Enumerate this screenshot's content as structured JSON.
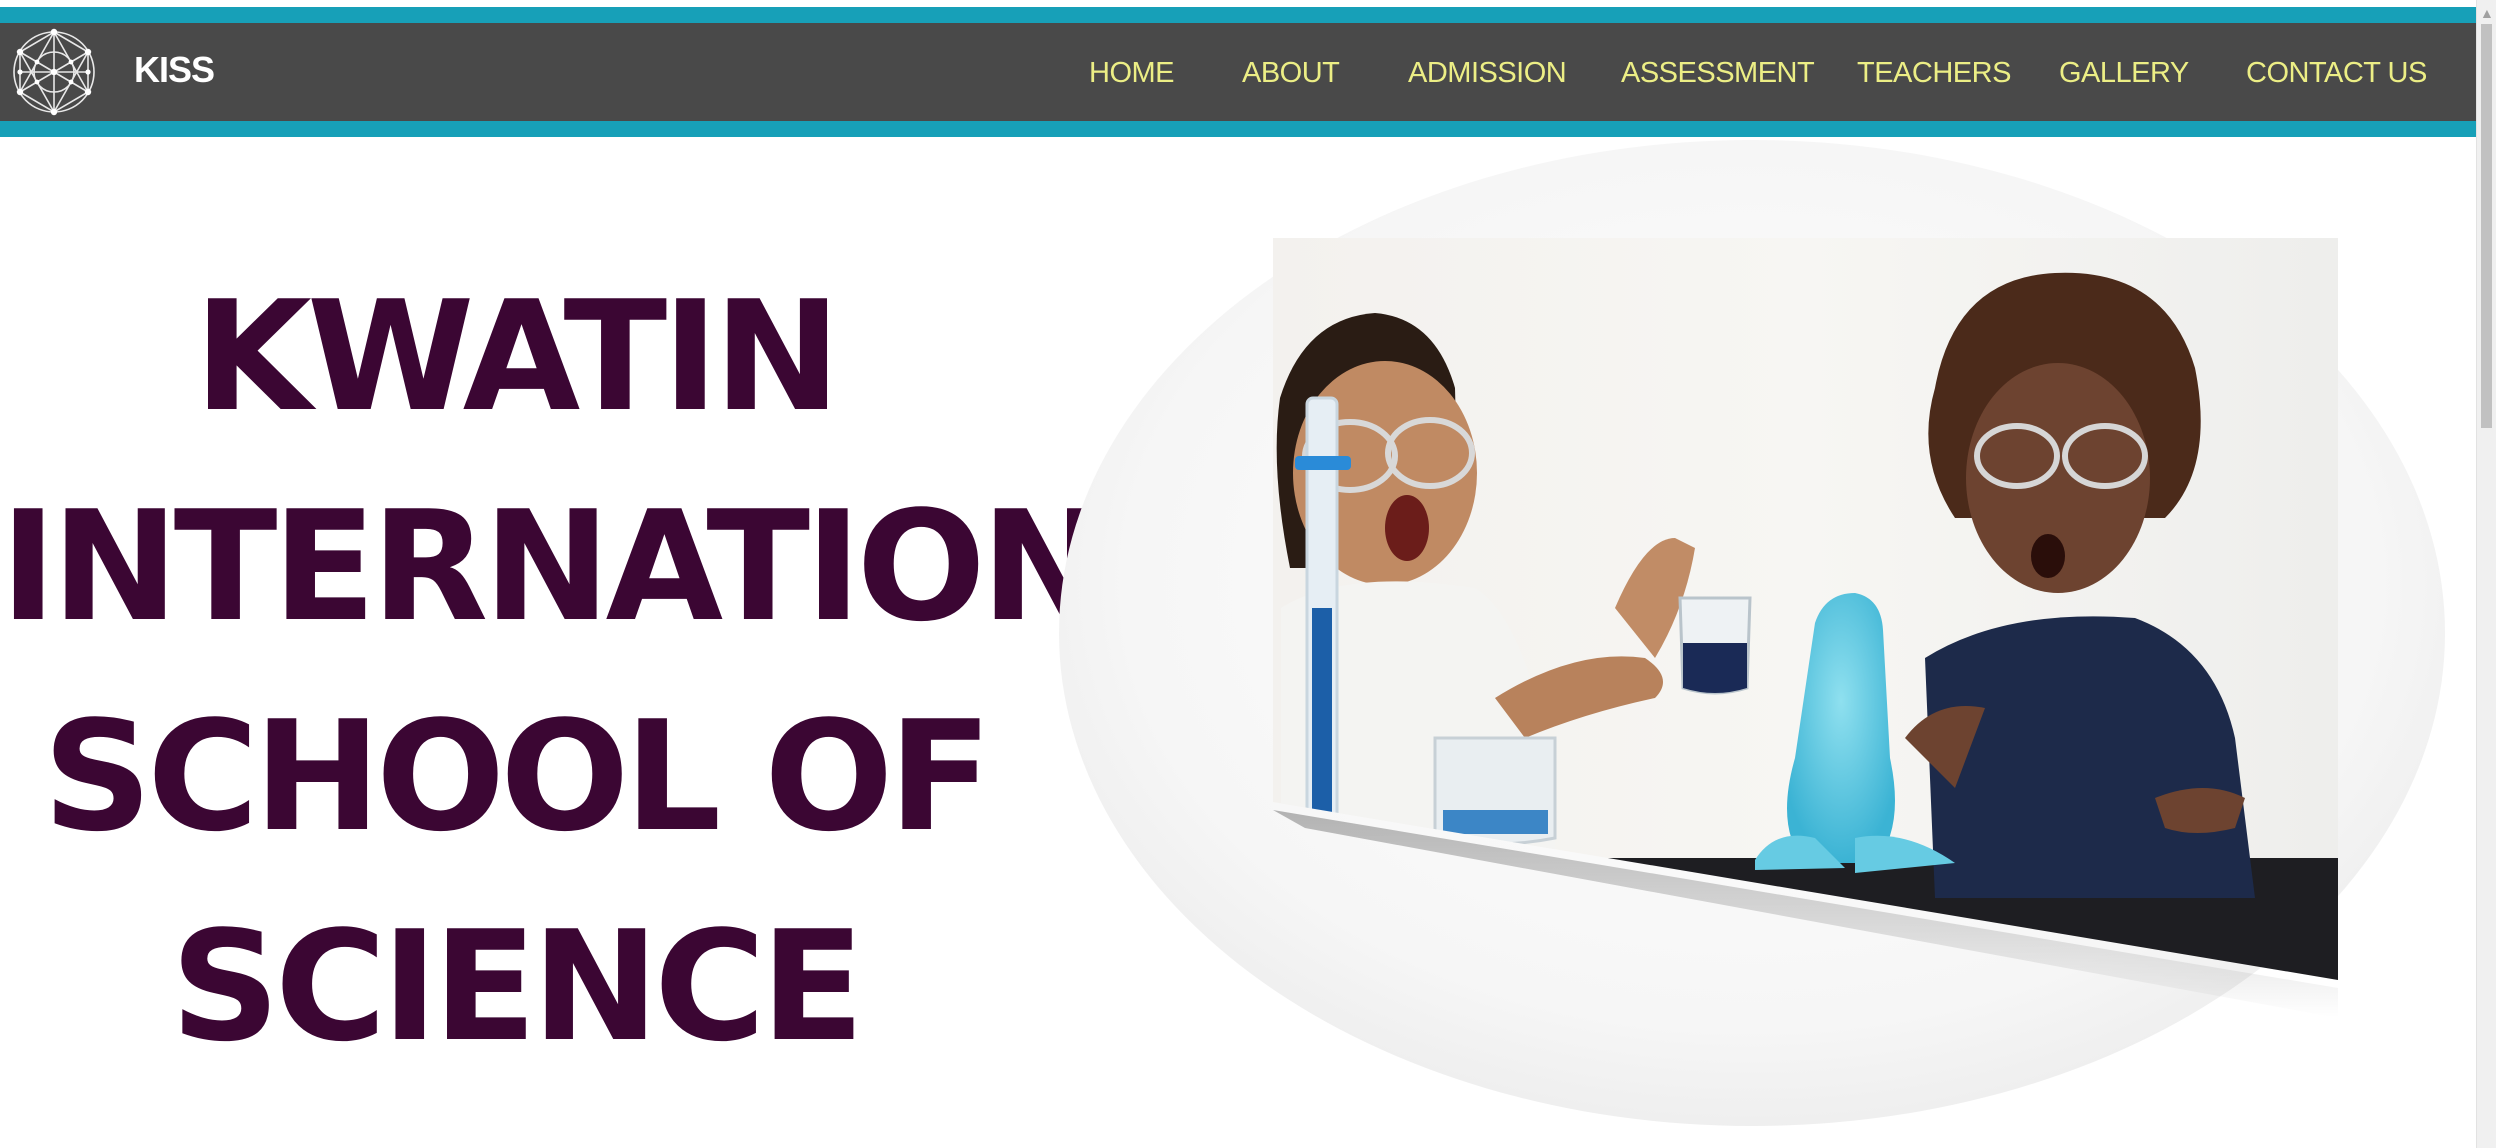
{
  "header": {
    "logo_icon": "network-globe-icon",
    "brand": "KISS",
    "nav": [
      "HOME",
      "ABOUT",
      "ADMISSION",
      "ASSESSMENT",
      "TEACHERS",
      "GALLERY",
      "CONTACT US"
    ]
  },
  "hero": {
    "title_lines": [
      "KWATIN",
      "INTERNATIONAL",
      "SCHOOL OF",
      "SCIENCE"
    ],
    "image_subject": "two children doing a science experiment with lab glassware"
  },
  "colors": {
    "accent": "#17a0b8",
    "navbar": "#494949",
    "nav_text": "#ecee85",
    "title": "#3b0633"
  }
}
